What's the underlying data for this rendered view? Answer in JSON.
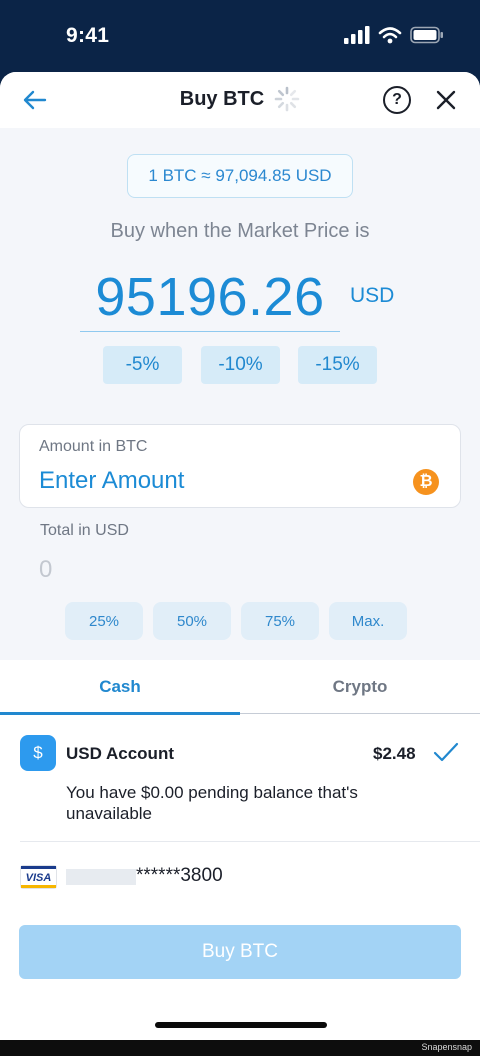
{
  "status_bar": {
    "time": "9:41"
  },
  "header": {
    "title": "Buy BTC",
    "help_label": "?"
  },
  "rate": {
    "text": "1 BTC ≈ 97,094.85 USD"
  },
  "market_price": {
    "label": "Buy when the Market Price is",
    "value": "95196.26",
    "unit": "USD",
    "adjustments": [
      "-5%",
      "-10%",
      "-15%"
    ]
  },
  "amount": {
    "label": "Amount in BTC",
    "placeholder": "Enter Amount",
    "coin_symbol": "₿"
  },
  "total": {
    "label": "Total in USD",
    "value": "0"
  },
  "allocation_buttons": [
    "25%",
    "50%",
    "75%",
    "Max."
  ],
  "tabs": [
    {
      "label": "Cash",
      "active": true
    },
    {
      "label": "Crypto",
      "active": false
    }
  ],
  "account": {
    "icon_symbol": "$",
    "name": "USD Account",
    "balance": "$2.48",
    "selected": true,
    "pending_note": "You have $0.00 pending balance that's unavailable"
  },
  "card": {
    "brand": "VISA",
    "number": "******3800"
  },
  "buy_button": {
    "label": "Buy BTC"
  },
  "watermark": "Snapensnap",
  "colors": {
    "accent": "#2188cf",
    "status_bar_bg": "#0b2447",
    "buy_button_disabled": "#a3d3f5",
    "btc_orange": "#f6921e"
  }
}
